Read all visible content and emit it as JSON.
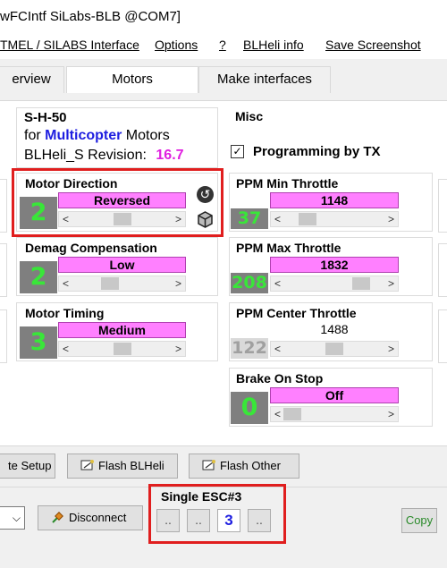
{
  "window": {
    "title": "wFCIntf SiLabs-BLB @COM7]"
  },
  "menu": {
    "items": [
      "TMEL / SILABS Interface",
      "Options",
      "?",
      "BLHeli info",
      "Save Screenshot"
    ]
  },
  "tabs": [
    "erview",
    "Motors",
    "Make interfaces"
  ],
  "info": {
    "line1": "S-H-50",
    "for_label": "for",
    "target": "Multicopter",
    "motors_label": "Motors",
    "revision_label": "BLHeli_S Revision:",
    "revision": "16.7"
  },
  "misc": {
    "title": "Misc",
    "programming_by_tx": "Programming by TX",
    "checkbox_glyph": "✓"
  },
  "motor_direction": {
    "label": "Motor Direction",
    "value": "2",
    "setting": "Reversed"
  },
  "demag": {
    "label": "Demag Compensation",
    "value": "2",
    "setting": "Low"
  },
  "motor_timing": {
    "label": "Motor Timing",
    "value": "3",
    "setting": "Medium"
  },
  "ppm_min": {
    "label": "PPM Min Throttle",
    "value": "37",
    "setting": "1148"
  },
  "ppm_max": {
    "label": "PPM Max Throttle",
    "value": "208",
    "setting": "1832"
  },
  "ppm_center": {
    "label": "PPM Center Throttle",
    "value": "122",
    "setting": "1488"
  },
  "brake": {
    "label": "Brake On Stop",
    "value": "0",
    "setting": "Off"
  },
  "scroll": {
    "left": "<",
    "right": ">"
  },
  "buttons": {
    "write_setup": "te Setup",
    "flash_blheli": "Flash BLHeli",
    "flash_other": "Flash Other",
    "disconnect": "Disconnect",
    "copy": "Copy"
  },
  "esc": {
    "title": "Single ESC#3",
    "buttons": [
      "..",
      "..",
      "3",
      ".."
    ]
  },
  "icons": {
    "restore": "undo-icon",
    "save": "cube-icon",
    "connector": "plug-icon"
  },
  "colors": {
    "accent_pink": "#ff80ff",
    "number_green": "#39e639",
    "revision_magenta": "#e020e0",
    "target_blue": "#1e1ee0",
    "highlight_red": "#e01e1e"
  },
  "controls": {
    "motor_direction_level": 0.5,
    "demag_level": 0.35,
    "motor_timing_level": 0.5,
    "ppm_min_level": 0.18,
    "ppm_max_level": 0.82,
    "ppm_center_level": 0.5,
    "brake_level": 0.0
  }
}
